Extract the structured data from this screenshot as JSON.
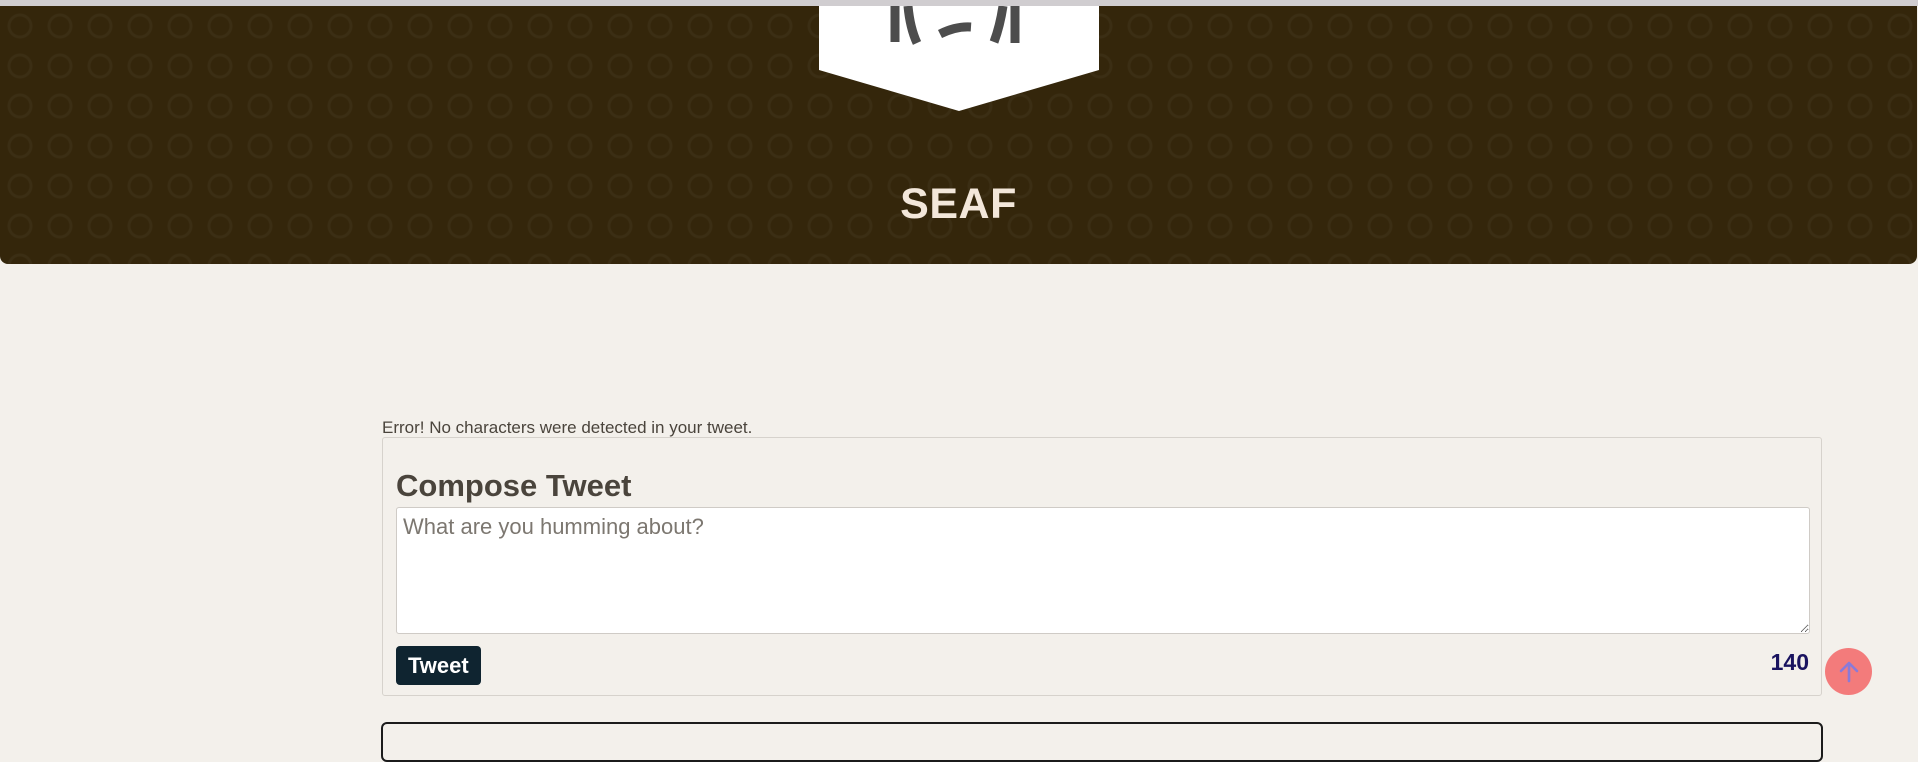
{
  "header": {
    "site_title": "SEAF",
    "logo_icon": "shield-logo-icon",
    "background_color": "#34260b",
    "title_color": "#f3e7da"
  },
  "compose": {
    "error_message": "Error! No characters were detected in your tweet.",
    "title": "Compose Tweet",
    "textarea_placeholder": "What are you humming about?",
    "textarea_value": "",
    "tweet_button_label": "Tweet",
    "char_count": "140",
    "button_color": "#0f2430",
    "counter_color": "#1a1460"
  },
  "scroll_top": {
    "icon": "arrow-up-icon",
    "color": "#f37b7b"
  }
}
